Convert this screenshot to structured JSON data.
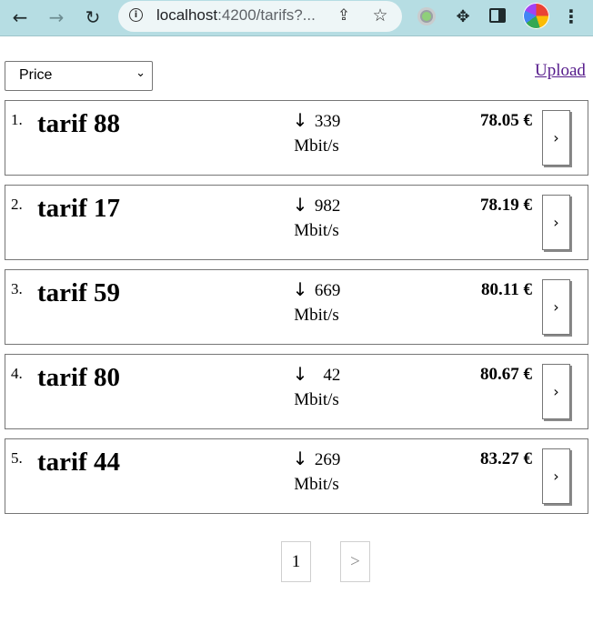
{
  "browser": {
    "back_icon": "arrow-left-icon",
    "forward_icon": "arrow-right-icon",
    "reload_icon": "reload-icon",
    "url_host": "localhost",
    "url_rest": ":4200/tarifs?...",
    "extensions_icon": "puzzle-icon",
    "menu_icon": "kebab-menu-icon"
  },
  "toolbar": {
    "sort_selected": "Price",
    "upload_label": "Upload"
  },
  "tariffs": [
    {
      "index": "1.",
      "name": "tarif 88",
      "speed": "339",
      "unit": "Mbit/s",
      "price": "78.05 €",
      "arrow": "↓",
      "go": "›"
    },
    {
      "index": "2.",
      "name": "tarif 17",
      "speed": "982",
      "unit": "Mbit/s",
      "price": "78.19 €",
      "arrow": "↓",
      "go": "›"
    },
    {
      "index": "3.",
      "name": "tarif 59",
      "speed": "669",
      "unit": "Mbit/s",
      "price": "80.11 €",
      "arrow": "↓",
      "go": "›"
    },
    {
      "index": "4.",
      "name": "tarif 80",
      "speed": "42",
      "unit": "Mbit/s",
      "price": "80.67 €",
      "arrow": "↓",
      "go": "›"
    },
    {
      "index": "5.",
      "name": "tarif 44",
      "speed": "269",
      "unit": "Mbit/s",
      "price": "83.27 €",
      "arrow": "↓",
      "go": "›"
    }
  ],
  "pagination": {
    "current_page": "1",
    "next_label": ">"
  },
  "colors": {
    "chrome_bg": "#b6dde3",
    "link_visited": "#551a8b"
  }
}
